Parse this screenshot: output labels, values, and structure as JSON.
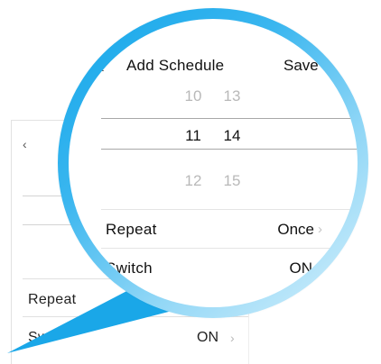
{
  "screen": {
    "back_icon": "chevron-left-icon",
    "back_glyph": "‹",
    "title": "Add Schedule",
    "save_label": "Save"
  },
  "picker": {
    "hours": [
      "10",
      "11",
      "12"
    ],
    "minutes": [
      "13",
      "14",
      "15"
    ],
    "selected_hour": "11",
    "selected_minute": "14"
  },
  "rows": {
    "repeat_label": "Repeat",
    "repeat_value": "Once",
    "switch_label": "Switch",
    "switch_value": "ON",
    "chevron_icon": "chevron-right-icon",
    "chevron_glyph": "›"
  },
  "background": {
    "back_glyph": "‹",
    "repeat_label": "Repeat",
    "switch_label": "Swi",
    "switch_value": "ON",
    "chevron_glyph": "›"
  },
  "colors": {
    "lens_ring_start": "#13a6ea",
    "lens_ring_end": "#d8f1fc",
    "pointer": "#1aa7e8",
    "dim_text": "#b9b9b9"
  }
}
